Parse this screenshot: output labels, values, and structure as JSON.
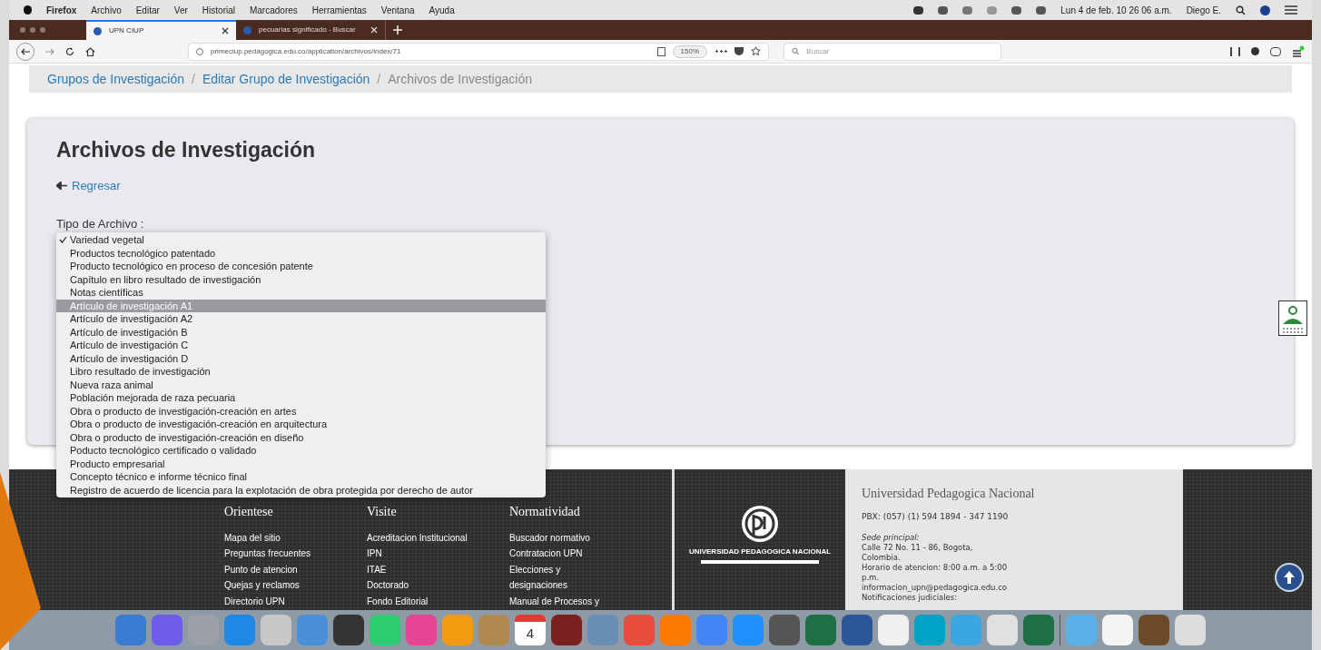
{
  "menu_bar": {
    "app": "Firefox",
    "items": [
      "Archivo",
      "Editar",
      "Ver",
      "Historial",
      "Marcadores",
      "Herramientas",
      "Ventana",
      "Ayuda"
    ],
    "clock": "Lun 4 de feb. 10 26 06 a.m.",
    "user": "Diego E."
  },
  "tabs": [
    {
      "label": "UPN CIUP",
      "selected": true
    },
    {
      "label": "pecuarias significado - Buscar",
      "selected": false
    }
  ],
  "address_bar": {
    "url": "primeciup.pedagogica.edu.co/application/archivos/index/71",
    "zoom": "150%"
  },
  "search": {
    "placeholder": "Buscar"
  },
  "breadcrumb_separator": "/",
  "breadcrumb": [
    {
      "label": "Grupos de Investigación",
      "kind": "link"
    },
    {
      "label": "Editar Grupo de Investigación",
      "kind": "link"
    },
    {
      "label": "Archivos de Investigación",
      "kind": "current"
    }
  ],
  "page": {
    "title": "Archivos de Investigación",
    "back_link": "Regresar",
    "field_label": "Tipo de Archivo :"
  },
  "dropdown": [
    {
      "label": "Variedad vegetal",
      "checked": true,
      "selected": false
    },
    {
      "label": "Productos tecnológico patentado",
      "checked": false,
      "selected": false
    },
    {
      "label": "Producto tecnológico en proceso de concesión patente",
      "checked": false,
      "selected": false
    },
    {
      "label": "Capítulo en libro resultado de investigación",
      "checked": false,
      "selected": false
    },
    {
      "label": "Notas científicas",
      "checked": false,
      "selected": false
    },
    {
      "label": "Artículo de investigación A1",
      "checked": false,
      "selected": true
    },
    {
      "label": "Artículo de investigación A2",
      "checked": false,
      "selected": false
    },
    {
      "label": "Artículo de investigación B",
      "checked": false,
      "selected": false
    },
    {
      "label": "Artículo de investigación C",
      "checked": false,
      "selected": false
    },
    {
      "label": "Artículo de investigación D",
      "checked": false,
      "selected": false
    },
    {
      "label": "Libro resultado de investigación",
      "checked": false,
      "selected": false
    },
    {
      "label": "Nueva raza animal",
      "checked": false,
      "selected": false
    },
    {
      "label": "Población mejorada de raza pecuaria",
      "checked": false,
      "selected": false
    },
    {
      "label": "Obra o producto de investigación-creación en artes",
      "checked": false,
      "selected": false
    },
    {
      "label": "Obra o producto de investigación-creación en arquitectura",
      "checked": false,
      "selected": false
    },
    {
      "label": "Obra o producto de investigación-creación en diseño",
      "checked": false,
      "selected": false
    },
    {
      "label": "Poducto tecnológico certificado o validado",
      "checked": false,
      "selected": false
    },
    {
      "label": "Producto empresarial",
      "checked": false,
      "selected": false
    },
    {
      "label": "Concepto técnico e informe técnico final",
      "checked": false,
      "selected": false
    },
    {
      "label": "Registro de acuerdo de licencia para la explotación de obra protegida por derecho de autor",
      "checked": false,
      "selected": false
    }
  ],
  "footer": {
    "columns": [
      {
        "heading": "Orientese",
        "links": [
          "Mapa del sitio",
          "Preguntas frecuentes",
          "Punto de atencion",
          "Quejas y reclamos",
          "Directorio UPN"
        ]
      },
      {
        "heading": "Visite",
        "links": [
          "Acreditacion Institucional",
          "IPN",
          "ITAE",
          "Doctorado",
          "Fondo Editorial"
        ]
      },
      {
        "heading": "Normatividad",
        "links": [
          "Buscador normativo",
          "Contratacion UPN",
          "Elecciones y",
          "designaciones",
          "Manual de Procesos y"
        ]
      }
    ],
    "logo_text": "UNIVERSIDAD PEDAGOGICA NACIONAL",
    "info": {
      "title": "Universidad Pedagogica Nacional",
      "phone": "PBX: (057) (1) 594 1894 - 347 1190",
      "lines": [
        {
          "text": "Sede principal:",
          "kind": "italic"
        },
        {
          "text": "Calle 72 No. 11 - 86, Bogota,",
          "kind": "plain"
        },
        {
          "text": "Colombia.",
          "kind": "plain"
        },
        {
          "text": "Horario de atencion: 8:00 a.m. a 5:00",
          "kind": "plain"
        },
        {
          "text": "p.m.",
          "kind": "plain"
        },
        {
          "text": "informacion_upn@pedagogica.edu.co",
          "kind": "plain"
        },
        {
          "text": "Notificaciones judiciales:",
          "kind": "plain"
        }
      ]
    }
  },
  "dock": {
    "calendar_day": "4"
  }
}
